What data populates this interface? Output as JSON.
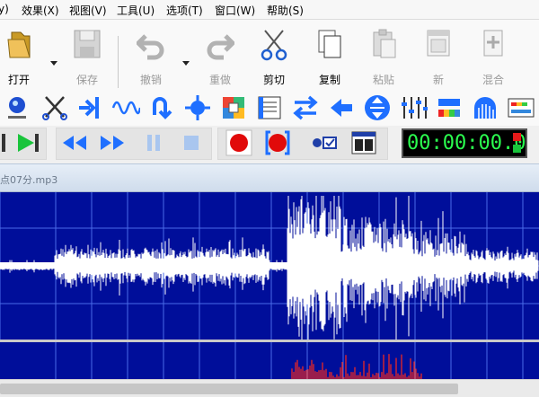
{
  "menu": {
    "items": [
      "y)",
      "效果(X)",
      "视图(V)",
      "工具(U)",
      "选项(T)",
      "窗口(W)",
      "帮助(S)"
    ]
  },
  "toolbar": {
    "open": "打开",
    "save": "保存",
    "undo": "撤销",
    "redo": "重做",
    "cut": "剪切",
    "copy": "复制",
    "paste": "粘贴",
    "new": "新",
    "mix": "混合"
  },
  "effects_toolbar": {
    "icons": [
      "selection-tool-icon",
      "trim-icon",
      "split-icon",
      "sine-wave-icon",
      "undo-arrow-icon",
      "normalize-icon",
      "plugins-icon",
      "notes-icon",
      "swap-channels-icon",
      "left-arrow-icon",
      "vertical-expand-icon",
      "equalizer-icon",
      "spectrum-gradient-icon",
      "arch-icon",
      "level-meter-icon"
    ]
  },
  "transport": {
    "icons": [
      "stop-marker-icon",
      "play-to-end-icon",
      "rewind-icon",
      "fast-forward-icon",
      "pause-icon",
      "stop-icon",
      "record-icon",
      "loop-record-icon",
      "record-options-icon",
      "monitor-window-icon"
    ],
    "time": "00:00:00.0"
  },
  "document": {
    "title": "点07分.mp3"
  },
  "colors": {
    "waveform_bg": "#000e9a",
    "waveform": "#ffffff",
    "grid": "#4a6be8",
    "spectrum": "#ff2a1a",
    "time_text": "#2bff4f",
    "record": "#e10a0a",
    "transport_blue": "#1f6fff"
  }
}
